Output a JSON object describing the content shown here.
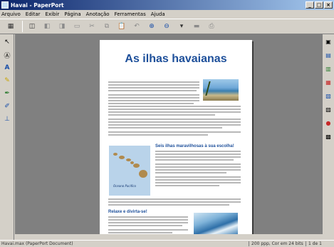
{
  "window": {
    "title": "Havai - PaperPort"
  },
  "menu": [
    "Arquivo",
    "Editar",
    "Exibir",
    "Página",
    "Anotação",
    "Ferramentas",
    "Ajuda"
  ],
  "document": {
    "title": "As ilhas havaianas",
    "section1_heading": "Seis ilhas maravilhosas à sua escolha!",
    "section2_heading": "Relaxe e divirta-se!",
    "map_label": "Oceano Pacífico"
  },
  "status": {
    "left": "Havai.max (PaperPort Document)",
    "middle": "200 ppp, Cor em 24 bits",
    "right": "1 de 1"
  }
}
